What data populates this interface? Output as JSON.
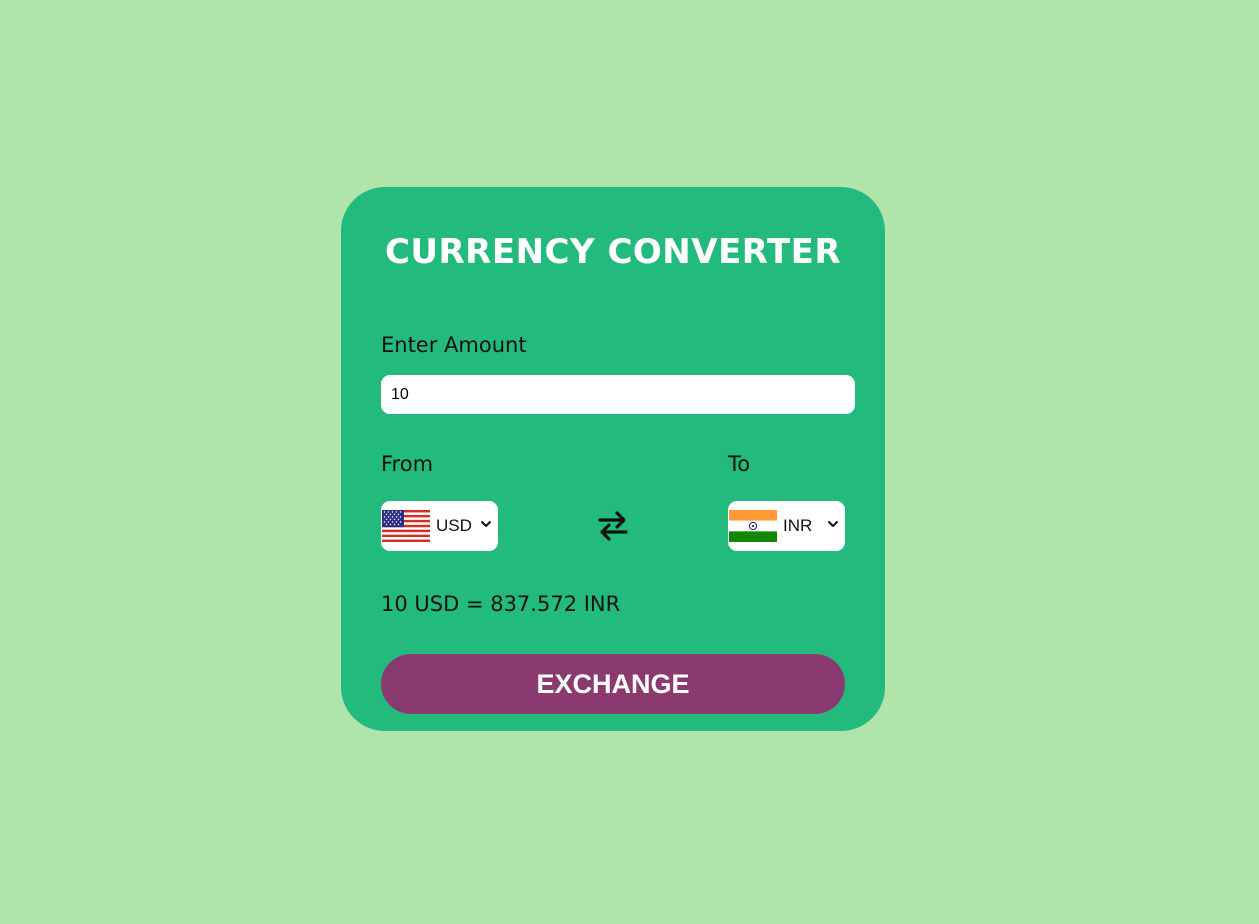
{
  "title": "CURRENCY CONVERTER",
  "amount": {
    "label": "Enter Amount",
    "value": "10"
  },
  "from": {
    "label": "From",
    "currency": "USD",
    "flag_icon": "us-flag-icon"
  },
  "to": {
    "label": "To",
    "currency": "INR",
    "flag_icon": "india-flag-icon"
  },
  "swap_icon": "swap-arrows-icon",
  "result": "10 USD = 837.572 INR",
  "button": {
    "label": "EXCHANGE"
  },
  "colors": {
    "background": "#afe5ab",
    "card": "#23ba7e",
    "button": "#8b3a70",
    "title": "#ffffff"
  }
}
